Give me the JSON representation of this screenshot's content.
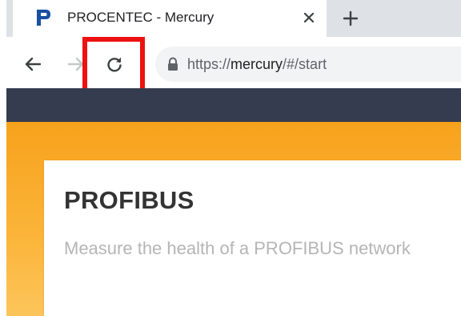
{
  "browser": {
    "tab": {
      "title": "PROCENTEC - Mercury",
      "favicon": "procentec-p-icon",
      "close_icon": "close-icon"
    },
    "new_tab_icon": "plus-icon",
    "toolbar": {
      "back_icon": "arrow-left-icon",
      "forward_icon": "arrow-right-icon",
      "reload_icon": "reload-icon",
      "lock_icon": "lock-icon"
    },
    "url": {
      "scheme": "https://",
      "host": "mercury",
      "path": "/#/start"
    },
    "highlight_color": "#ee1111"
  },
  "site": {
    "header_color": "#353c4f",
    "accent_color": "#f7a21c",
    "card": {
      "title": "PROFIBUS",
      "description": "Measure the health of a PROFIBUS network"
    }
  }
}
